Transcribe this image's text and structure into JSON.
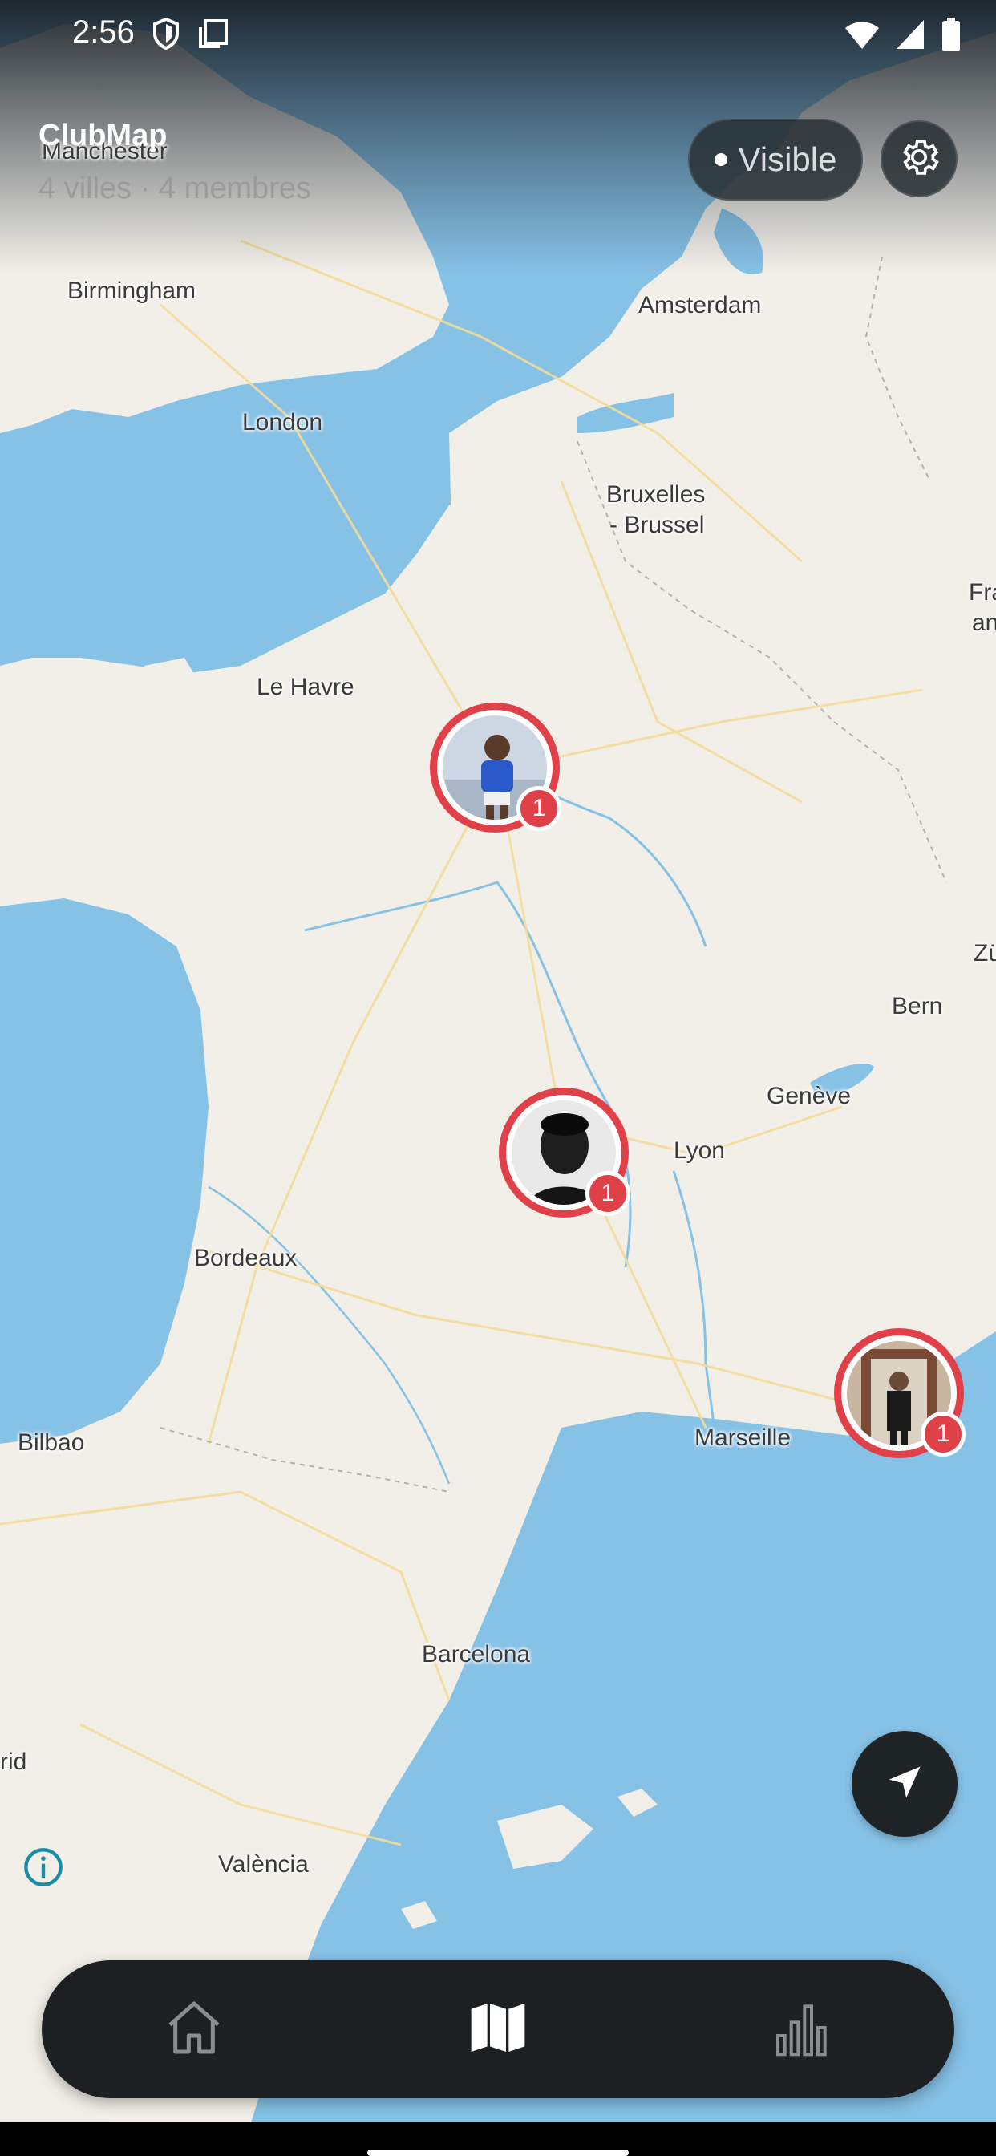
{
  "status_bar": {
    "time": "2:56",
    "left_icons": [
      "shield-icon",
      "copy-icon"
    ],
    "right_icons": [
      "wifi-icon",
      "signal-icon",
      "battery-icon"
    ]
  },
  "header": {
    "title": "ClubMap",
    "subtitle": "4 villes · 4 membres",
    "visibility_label": "Visible",
    "settings_icon": "gear-icon"
  },
  "map": {
    "land_color": "#f2efe8",
    "water_color": "#86c1e6",
    "labels": [
      "Manchester",
      "Birmingham",
      "London",
      "Amsterdam",
      "Bruxelles",
      "- Brussel",
      "Fra",
      "an",
      "Le Havre",
      "Zü",
      "Bern",
      "Genève",
      "Lyon",
      "Bordeaux",
      "Bilbao",
      "Marseille",
      "Barcelona",
      "rid",
      "València"
    ]
  },
  "markers": [
    {
      "location": "near Paris",
      "count": "1",
      "avatar": "child-in-blue-shirt-avatar"
    },
    {
      "location": "near Lyon",
      "count": "1",
      "avatar": "man-portrait-bw-avatar"
    },
    {
      "location": "near Nice",
      "count": "1",
      "avatar": "man-in-suit-avatar"
    }
  ],
  "controls": {
    "locate_icon": "navigation-arrow-icon",
    "info_icon": "info-icon"
  },
  "bottom_nav": {
    "items": [
      {
        "icon": "home-icon",
        "active": false
      },
      {
        "icon": "map-icon",
        "active": true
      },
      {
        "icon": "bar-chart-icon",
        "active": false
      }
    ]
  },
  "colors": {
    "accent_red": "#e04149",
    "nav_background": "#1d2022"
  }
}
